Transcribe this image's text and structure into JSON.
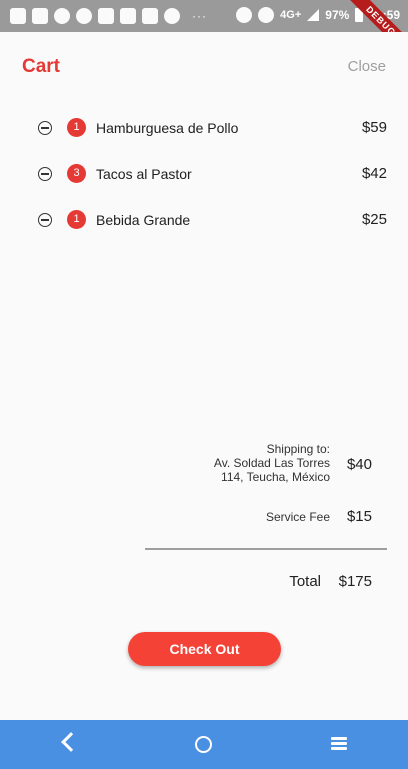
{
  "status_bar": {
    "network": "4G+",
    "battery": "97%",
    "time": "00:59",
    "more": "···",
    "icons": [
      "news-icon",
      "game-icon",
      "telegram-icon",
      "whatsapp-icon",
      "facebook-icon",
      "facebook-icon",
      "youtube-icon",
      "tinder-icon",
      "dnd-icon",
      "alarm-icon",
      "signal-icon",
      "battery-icon"
    ]
  },
  "debug_banner": "DEBUG",
  "header": {
    "title": "Cart",
    "close_label": "Close"
  },
  "colors": {
    "accent": "#e53935",
    "button": "#f44336",
    "navbar": "#4a90e2"
  },
  "items": [
    {
      "qty": "1",
      "name": "Hamburguesa de Pollo",
      "price": "$59"
    },
    {
      "qty": "3",
      "name": "Tacos al Pastor",
      "price": "$42"
    },
    {
      "qty": "1",
      "name": "Bebida Grande",
      "price": "$25"
    }
  ],
  "summary": {
    "shipping_label_1": "Shipping to:",
    "shipping_label_2": "Av. Soldad Las Torres",
    "shipping_label_3": "114, Teucha, México",
    "shipping_price": "$40",
    "fee_label": "Service Fee",
    "fee_price": "$15",
    "total_label": "Total",
    "total_price": "$175"
  },
  "checkout_label": "Check Out",
  "navbar": {
    "icons": [
      "back-icon",
      "home-icon",
      "recents-icon"
    ]
  }
}
